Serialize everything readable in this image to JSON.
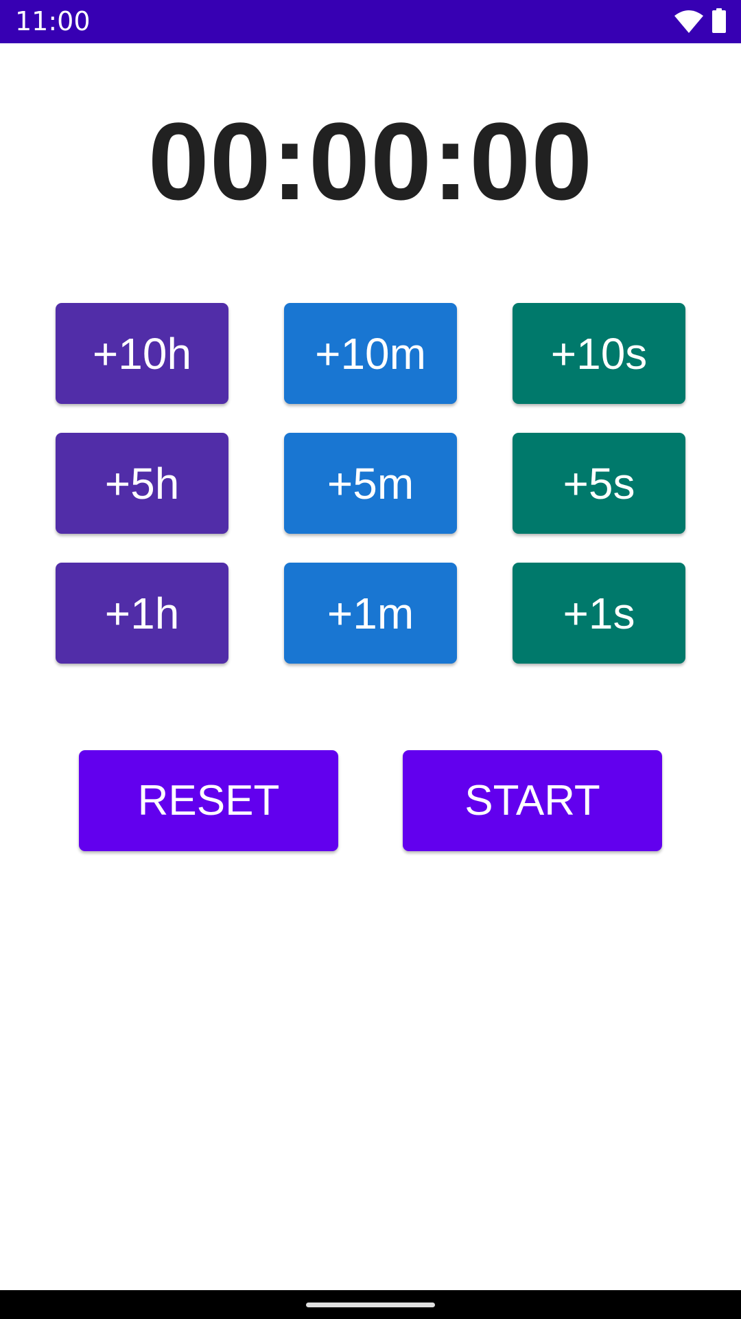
{
  "status_bar": {
    "time": "11:00",
    "background": "#3700b3",
    "icons": [
      "wifi-icon",
      "battery-icon"
    ]
  },
  "timer": {
    "display": "00:00:00",
    "color": "#212121"
  },
  "increment_buttons": {
    "hours": {
      "color": "#512da8",
      "labels": [
        "+10h",
        "+5h",
        "+1h"
      ]
    },
    "minutes": {
      "color": "#1976d2",
      "labels": [
        "+10m",
        "+5m",
        "+1m"
      ]
    },
    "seconds": {
      "color": "#00796b",
      "labels": [
        "+10s",
        "+5s",
        "+1s"
      ]
    }
  },
  "actions": {
    "reset_label": "RESET",
    "start_label": "START",
    "color": "#6200ee"
  },
  "nav_bar": {
    "icons": [
      "home-handle"
    ]
  }
}
